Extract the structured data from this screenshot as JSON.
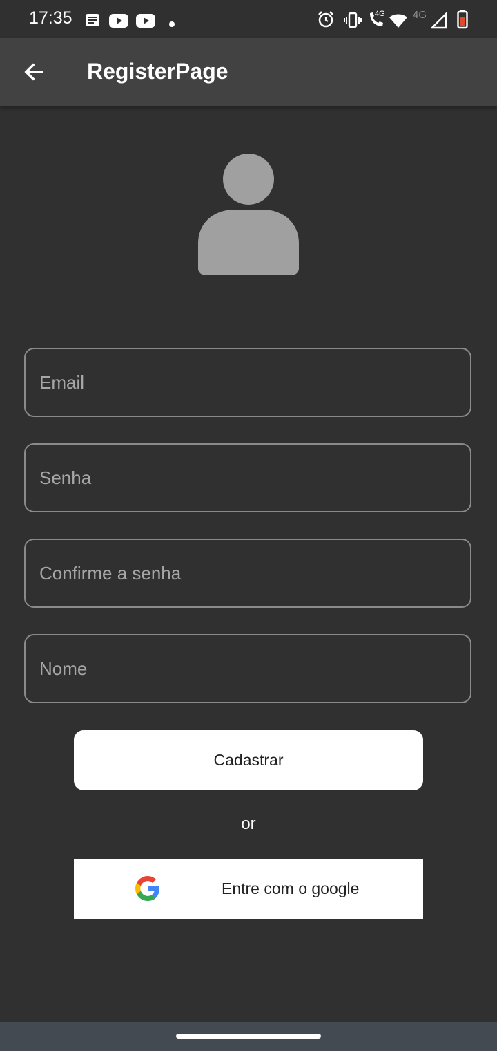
{
  "status_bar": {
    "time": "17:35",
    "network_label": "4G",
    "call_network_label": "4G",
    "icons": [
      "news-icon",
      "youtube-icon",
      "youtube-icon",
      "dot-icon",
      "alarm-icon",
      "vibrate-icon",
      "volte-call-icon",
      "wifi-icon",
      "signal-icon",
      "battery-icon"
    ]
  },
  "app_bar": {
    "title": "RegisterPage",
    "back_icon": "arrow-back-icon",
    "background": "#424242"
  },
  "avatar": {
    "icon": "person-icon",
    "color": "#a0a0a0"
  },
  "form": {
    "email_placeholder": "Email",
    "email_value": "",
    "password_placeholder": "Senha",
    "password_value": "",
    "confirm_password_placeholder": "Confirme a senha",
    "confirm_password_value": "",
    "name_placeholder": "Nome",
    "name_value": ""
  },
  "actions": {
    "register_label": "Cadastrar",
    "separator_label": "or",
    "google_label": "Entre com o google",
    "google_icon": "google-icon"
  },
  "colors": {
    "background": "#303030",
    "field_border": "#8a8a8a",
    "placeholder": "#a6a6a6",
    "nav_bar": "#434a52"
  }
}
